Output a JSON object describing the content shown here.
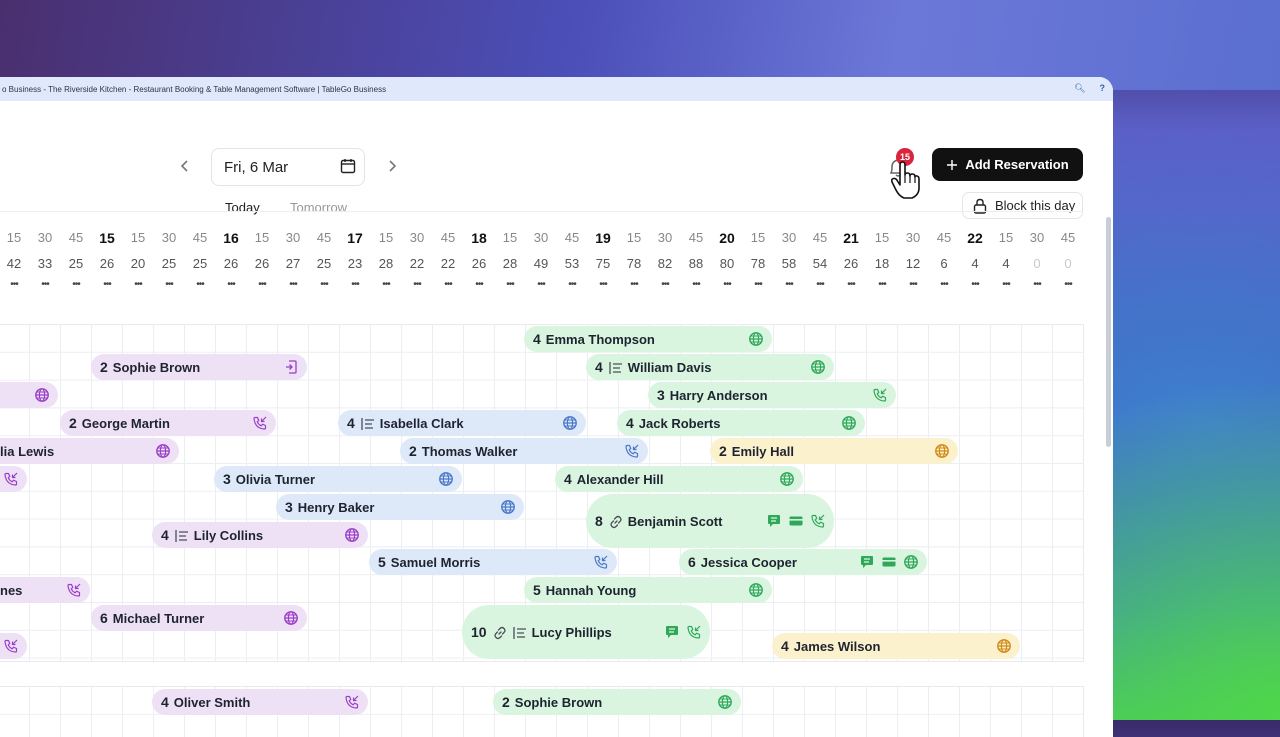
{
  "browser": {
    "title": "o Business - The Riverside Kitchen - Restaurant Booking & Table Management Software | TableGo Business"
  },
  "header": {
    "date_label": "Fri, 6 Mar",
    "today_label": "Today",
    "tomorrow_label": "Tomorrow",
    "notification_count": "15",
    "add_reservation_label": "Add Reservation",
    "block_day_label": "Block this day"
  },
  "timeline": {
    "ticks": [
      {
        "label": "15",
        "hour": false,
        "count": "42"
      },
      {
        "label": "30",
        "hour": false,
        "count": "33"
      },
      {
        "label": "45",
        "hour": false,
        "count": "25"
      },
      {
        "label": "15",
        "hour": true,
        "count": "26"
      },
      {
        "label": "15",
        "hour": false,
        "count": "20"
      },
      {
        "label": "30",
        "hour": false,
        "count": "25"
      },
      {
        "label": "45",
        "hour": false,
        "count": "25"
      },
      {
        "label": "16",
        "hour": true,
        "count": "26"
      },
      {
        "label": "15",
        "hour": false,
        "count": "26"
      },
      {
        "label": "30",
        "hour": false,
        "count": "27"
      },
      {
        "label": "45",
        "hour": false,
        "count": "25"
      },
      {
        "label": "17",
        "hour": true,
        "count": "23"
      },
      {
        "label": "15",
        "hour": false,
        "count": "28"
      },
      {
        "label": "30",
        "hour": false,
        "count": "22"
      },
      {
        "label": "45",
        "hour": false,
        "count": "22"
      },
      {
        "label": "18",
        "hour": true,
        "count": "26"
      },
      {
        "label": "15",
        "hour": false,
        "count": "28"
      },
      {
        "label": "30",
        "hour": false,
        "count": "49"
      },
      {
        "label": "45",
        "hour": false,
        "count": "53"
      },
      {
        "label": "19",
        "hour": true,
        "count": "75"
      },
      {
        "label": "15",
        "hour": false,
        "count": "78"
      },
      {
        "label": "30",
        "hour": false,
        "count": "82"
      },
      {
        "label": "45",
        "hour": false,
        "count": "88"
      },
      {
        "label": "20",
        "hour": true,
        "count": "80"
      },
      {
        "label": "15",
        "hour": false,
        "count": "78"
      },
      {
        "label": "30",
        "hour": false,
        "count": "58"
      },
      {
        "label": "45",
        "hour": false,
        "count": "54"
      },
      {
        "label": "21",
        "hour": true,
        "count": "26"
      },
      {
        "label": "15",
        "hour": false,
        "count": "18"
      },
      {
        "label": "30",
        "hour": false,
        "count": "12"
      },
      {
        "label": "45",
        "hour": false,
        "count": "6"
      },
      {
        "label": "22",
        "hour": true,
        "count": "4"
      },
      {
        "label": "15",
        "hour": false,
        "count": "4"
      },
      {
        "label": "30",
        "hour": false,
        "count": "0"
      },
      {
        "label": "45",
        "hour": false,
        "count": "0"
      }
    ],
    "more_glyph": "•••"
  },
  "reservations": [
    {
      "party": "4",
      "name": "Emma Thompson",
      "color": "green",
      "icons": [
        "globe-icon"
      ]
    },
    {
      "party": "2",
      "name": "Sophie Brown",
      "color": "purple",
      "icons": [
        "walk-in-icon"
      ]
    },
    {
      "party": "4",
      "name": "William Davis",
      "color": "green",
      "icons": [
        "notes-icon",
        "globe-icon"
      ]
    },
    {
      "party": "",
      "name": "",
      "color": "purple",
      "icons": [
        "globe-icon"
      ]
    },
    {
      "party": "3",
      "name": "Harry Anderson",
      "color": "green",
      "icons": [
        "phone-icon"
      ]
    },
    {
      "party": "2",
      "name": "George Martin",
      "color": "purple",
      "icons": [
        "phone-icon"
      ]
    },
    {
      "party": "4",
      "name": "Isabella Clark",
      "color": "blue",
      "icons": [
        "notes-icon",
        "globe-icon"
      ]
    },
    {
      "party": "4",
      "name": "Jack Roberts",
      "color": "green",
      "icons": [
        "globe-icon"
      ]
    },
    {
      "party": "",
      "name": "lia Lewis",
      "color": "purple",
      "icons": [
        "globe-icon"
      ]
    },
    {
      "party": "2",
      "name": "Thomas Walker",
      "color": "blue",
      "icons": [
        "phone-icon"
      ]
    },
    {
      "party": "2",
      "name": "Emily Hall",
      "color": "yellow",
      "icons": [
        "globe-icon"
      ]
    },
    {
      "party": "",
      "name": "",
      "color": "purple",
      "icons": [
        "phone-icon"
      ]
    },
    {
      "party": "3",
      "name": "Olivia Turner",
      "color": "blue",
      "icons": [
        "globe-icon"
      ]
    },
    {
      "party": "4",
      "name": "Alexander Hill",
      "color": "green",
      "icons": [
        "globe-icon"
      ]
    },
    {
      "party": "3",
      "name": "Henry Baker",
      "color": "blue",
      "icons": [
        "globe-icon"
      ]
    },
    {
      "party": "8",
      "name": "Benjamin Scott",
      "color": "green",
      "icons": [
        "link-icon",
        "chat-icon",
        "card-icon",
        "phone-icon"
      ]
    },
    {
      "party": "4",
      "name": "Lily Collins",
      "color": "purple",
      "icons": [
        "notes-icon",
        "globe-icon"
      ]
    },
    {
      "party": "5",
      "name": "Samuel Morris",
      "color": "blue",
      "icons": [
        "phone-icon"
      ]
    },
    {
      "party": "6",
      "name": "Jessica Cooper",
      "color": "green",
      "icons": [
        "chat-icon",
        "card-icon",
        "globe-icon"
      ]
    },
    {
      "party": "",
      "name": "nes",
      "color": "purple",
      "icons": [
        "phone-icon"
      ]
    },
    {
      "party": "5",
      "name": "Hannah Young",
      "color": "green",
      "icons": [
        "globe-icon"
      ]
    },
    {
      "party": "6",
      "name": "Michael Turner",
      "color": "purple",
      "icons": [
        "globe-icon"
      ]
    },
    {
      "party": "10",
      "name": "Lucy Phillips",
      "color": "green",
      "icons": [
        "link-icon",
        "notes-icon",
        "chat-icon",
        "phone-icon"
      ]
    },
    {
      "party": "",
      "name": "",
      "color": "purple",
      "icons": [
        "phone-icon"
      ]
    },
    {
      "party": "4",
      "name": "James Wilson",
      "color": "yellow",
      "icons": [
        "globe-icon"
      ]
    },
    {
      "party": "4",
      "name": "Oliver Smith",
      "color": "purple",
      "icons": [
        "phone-icon"
      ]
    },
    {
      "party": "2",
      "name": "Sophie Brown",
      "color": "green",
      "icons": [
        "globe-icon"
      ]
    }
  ]
}
